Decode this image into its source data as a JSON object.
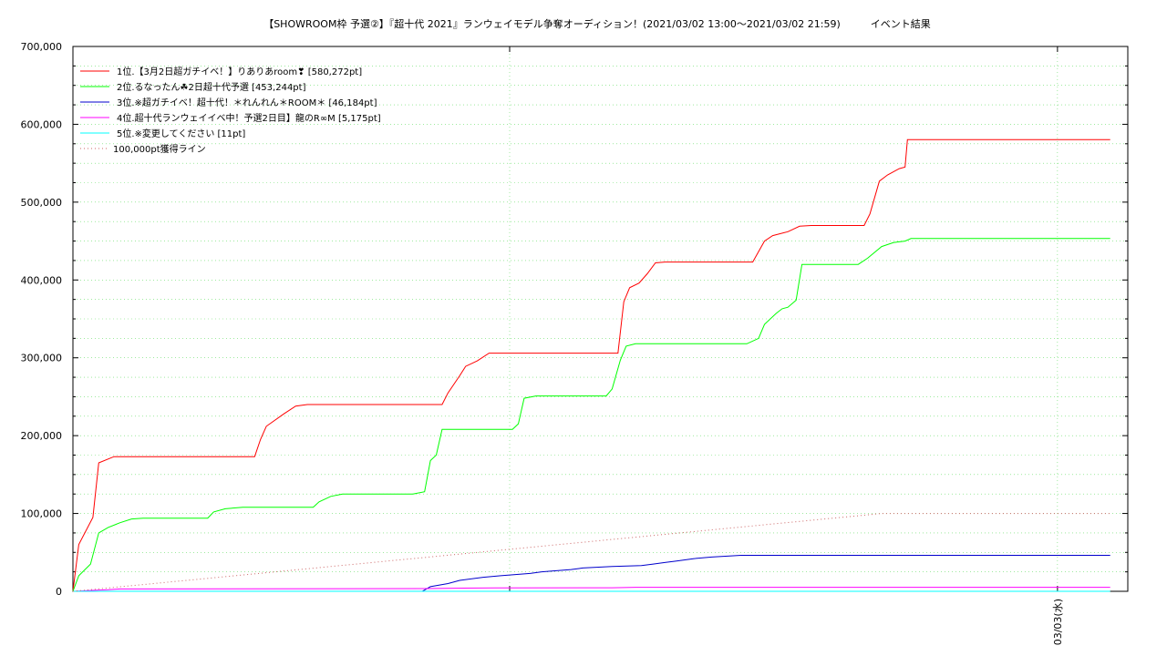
{
  "chart_data": {
    "type": "line",
    "title": "【SHOWROOM枠 予選②】『超十代 2021』ランウェイモデル争奪オーディション！(2021/03/02 13:00～2021/03/02 21:59)　　　イベント結果",
    "ylim": [
      0,
      700000
    ],
    "yticks": [
      "0",
      "100,000",
      "200,000",
      "300,000",
      "400,000",
      "500,000",
      "600,000",
      "700,000"
    ],
    "x_tick_label": "03/03(水)",
    "x_range_hours": [
      0,
      9
    ],
    "grid": true,
    "legend_position": "top-left",
    "series": [
      {
        "name": "1位.【3月2日超ガチイベ！】りありあroom❣ [580,272pt]",
        "color": "#ff0000",
        "points": [
          [
            0,
            0
          ],
          [
            0.05,
            60000
          ],
          [
            0.17,
            95000
          ],
          [
            0.22,
            165000
          ],
          [
            0.35,
            173000
          ],
          [
            1.2,
            173000
          ],
          [
            1.55,
            173000
          ],
          [
            1.6,
            195000
          ],
          [
            1.65,
            212000
          ],
          [
            1.8,
            228000
          ],
          [
            1.9,
            238000
          ],
          [
            2.0,
            240000
          ],
          [
            2.5,
            240000
          ],
          [
            3.15,
            240000
          ],
          [
            3.2,
            255000
          ],
          [
            3.3,
            277000
          ],
          [
            3.35,
            289000
          ],
          [
            3.45,
            296000
          ],
          [
            3.55,
            306000
          ],
          [
            4.0,
            306000
          ],
          [
            4.65,
            306000
          ],
          [
            4.7,
            372000
          ],
          [
            4.75,
            390000
          ],
          [
            4.83,
            396000
          ],
          [
            4.9,
            408000
          ],
          [
            4.97,
            422000
          ],
          [
            5.05,
            423000
          ],
          [
            5.5,
            423000
          ],
          [
            5.8,
            423000
          ],
          [
            5.9,
            450000
          ],
          [
            5.97,
            457000
          ],
          [
            6.1,
            462000
          ],
          [
            6.2,
            469000
          ],
          [
            6.3,
            470000
          ],
          [
            6.6,
            470000
          ],
          [
            6.75,
            470000
          ],
          [
            6.8,
            485000
          ],
          [
            6.88,
            527000
          ],
          [
            6.95,
            535000
          ],
          [
            7.05,
            543000
          ],
          [
            7.1,
            545000
          ],
          [
            7.12,
            580272
          ],
          [
            8.5,
            580272
          ],
          [
            8.85,
            580272
          ]
        ]
      },
      {
        "name": "2位.るなったん☘2日超十代予選 [453,244pt]",
        "color": "#00ff00",
        "points": [
          [
            0,
            0
          ],
          [
            0.05,
            20000
          ],
          [
            0.15,
            35000
          ],
          [
            0.22,
            75000
          ],
          [
            0.3,
            82000
          ],
          [
            0.4,
            88000
          ],
          [
            0.5,
            93000
          ],
          [
            0.6,
            94000
          ],
          [
            1.0,
            94000
          ],
          [
            1.15,
            94000
          ],
          [
            1.2,
            102000
          ],
          [
            1.3,
            106000
          ],
          [
            1.45,
            108000
          ],
          [
            1.9,
            108000
          ],
          [
            2.05,
            108000
          ],
          [
            2.1,
            115000
          ],
          [
            2.2,
            122000
          ],
          [
            2.3,
            125000
          ],
          [
            2.9,
            125000
          ],
          [
            3.0,
            128000
          ],
          [
            3.05,
            168000
          ],
          [
            3.1,
            175000
          ],
          [
            3.15,
            208000
          ],
          [
            3.6,
            208000
          ],
          [
            3.75,
            208000
          ],
          [
            3.8,
            215000
          ],
          [
            3.85,
            248000
          ],
          [
            3.95,
            251000
          ],
          [
            4.4,
            251000
          ],
          [
            4.55,
            251000
          ],
          [
            4.6,
            260000
          ],
          [
            4.67,
            297000
          ],
          [
            4.72,
            315000
          ],
          [
            4.8,
            318000
          ],
          [
            5.2,
            318000
          ],
          [
            5.75,
            318000
          ],
          [
            5.85,
            325000
          ],
          [
            5.9,
            343000
          ],
          [
            6.0,
            357000
          ],
          [
            6.05,
            363000
          ],
          [
            6.1,
            365000
          ],
          [
            6.17,
            374000
          ],
          [
            6.22,
            420000
          ],
          [
            6.6,
            420000
          ],
          [
            6.7,
            420000
          ],
          [
            6.78,
            428000
          ],
          [
            6.9,
            443000
          ],
          [
            7.0,
            448000
          ],
          [
            7.05,
            449000
          ],
          [
            7.1,
            450000
          ],
          [
            7.15,
            453244
          ],
          [
            8.85,
            453244
          ]
        ]
      },
      {
        "name": "3位.※超ガチイベ！超十代！＊れんれん＊ROOM＊ [46,184pt]",
        "color": "#0000cc",
        "points": [
          [
            0,
            0
          ],
          [
            2.98,
            0
          ],
          [
            3.05,
            6000
          ],
          [
            3.2,
            10000
          ],
          [
            3.3,
            14000
          ],
          [
            3.5,
            18000
          ],
          [
            3.65,
            20000
          ],
          [
            3.9,
            23000
          ],
          [
            4.0,
            25000
          ],
          [
            4.25,
            28000
          ],
          [
            4.35,
            30000
          ],
          [
            4.6,
            32000
          ],
          [
            4.85,
            33000
          ],
          [
            4.95,
            35000
          ],
          [
            5.05,
            37000
          ],
          [
            5.15,
            39000
          ],
          [
            5.3,
            42000
          ],
          [
            5.45,
            44000
          ],
          [
            5.55,
            45000
          ],
          [
            5.7,
            46184
          ],
          [
            8.85,
            46184
          ]
        ]
      },
      {
        "name": "4位.超十代ランウェイイベ中！予選2日目】龍のR∞M [5,175pt]",
        "color": "#ff00ff",
        "points": [
          [
            0,
            0
          ],
          [
            0.3,
            2000
          ],
          [
            0.4,
            3000
          ],
          [
            3.0,
            3500
          ],
          [
            3.6,
            4500
          ],
          [
            4.6,
            4600
          ],
          [
            4.8,
            5175
          ],
          [
            8.85,
            5175
          ]
        ]
      },
      {
        "name": "5位.※変更してください [11pt]",
        "color": "#00ffff",
        "points": [
          [
            0,
            0
          ],
          [
            0.2,
            11
          ],
          [
            8.85,
            11
          ]
        ]
      },
      {
        "name": "100,000pt獲得ライン",
        "color": "#cc6666",
        "dashed": true,
        "points": [
          [
            0,
            0
          ],
          [
            6.9,
            100000
          ],
          [
            8.85,
            100000
          ]
        ]
      }
    ]
  }
}
